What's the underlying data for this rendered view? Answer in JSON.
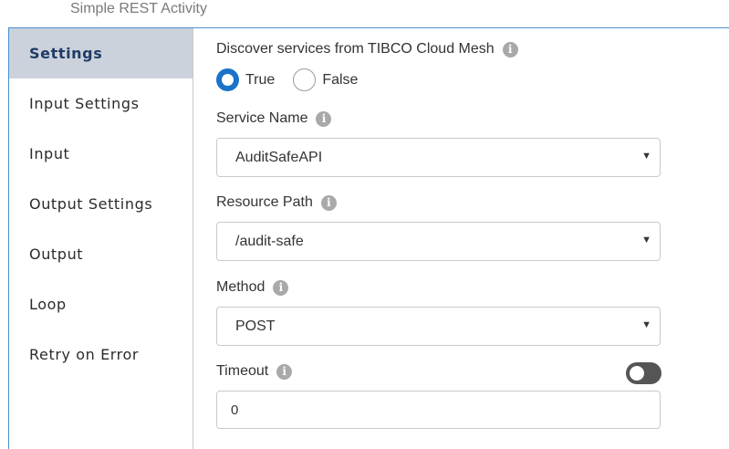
{
  "activity": {
    "title": "Simple REST Activity"
  },
  "sidebar": {
    "items": [
      {
        "label": "Settings",
        "active": true
      },
      {
        "label": "Input Settings",
        "active": false
      },
      {
        "label": "Input",
        "active": false
      },
      {
        "label": "Output Settings",
        "active": false
      },
      {
        "label": "Output",
        "active": false
      },
      {
        "label": "Loop",
        "active": false
      },
      {
        "label": "Retry on Error",
        "active": false
      }
    ]
  },
  "settings": {
    "discover": {
      "label": "Discover services from TIBCO Cloud Mesh",
      "options": [
        "True",
        "False"
      ],
      "selected": "True"
    },
    "service_name": {
      "label": "Service Name",
      "value": "AuditSafeAPI"
    },
    "resource_path": {
      "label": "Resource Path",
      "value": "/audit-safe"
    },
    "method": {
      "label": "Method",
      "value": "POST"
    },
    "timeout": {
      "label": "Timeout",
      "value": "0",
      "toggle_on": false
    }
  },
  "icons": {
    "info": "i",
    "caret": "▼"
  },
  "colors": {
    "accent": "#1a73c9",
    "active_tab_bg": "#ccd2db",
    "border_blue": "#4a8fd0"
  }
}
